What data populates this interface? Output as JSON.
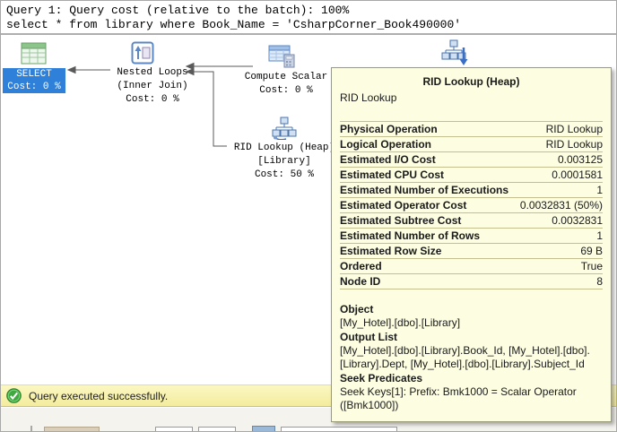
{
  "query_header": {
    "line1": "Query 1: Query cost (relative to the batch): 100%",
    "line2": "select * from library where Book_Name = 'CsharpCorner_Book490000'"
  },
  "plan": {
    "select": {
      "title": "SELECT",
      "cost": "Cost: 0 %"
    },
    "nested_loops": {
      "line1": "Nested Loops",
      "line2": "(Inner Join)",
      "cost": "Cost: 0 %"
    },
    "compute_scalar": {
      "line1": "Compute Scalar",
      "cost": "Cost: 0 %"
    },
    "rid_lookup": {
      "line1": "RID Lookup (Heap)",
      "line2": "[Library]",
      "cost": "Cost: 50 %"
    }
  },
  "tooltip": {
    "title": "RID Lookup (Heap)",
    "subtitle": "RID Lookup",
    "rows": [
      {
        "label": "Physical Operation",
        "value": "RID Lookup"
      },
      {
        "label": "Logical Operation",
        "value": "RID Lookup"
      },
      {
        "label": "Estimated I/O Cost",
        "value": "0.003125"
      },
      {
        "label": "Estimated CPU Cost",
        "value": "0.0001581"
      },
      {
        "label": "Estimated Number of Executions",
        "value": "1"
      },
      {
        "label": "Estimated Operator Cost",
        "value": "0.0032831 (50%)"
      },
      {
        "label": "Estimated Subtree Cost",
        "value": "0.0032831"
      },
      {
        "label": "Estimated Number of Rows",
        "value": "1"
      },
      {
        "label": "Estimated Row Size",
        "value": "69 B"
      },
      {
        "label": "Ordered",
        "value": "True"
      },
      {
        "label": "Node ID",
        "value": "8"
      }
    ],
    "sections": [
      {
        "heading": "Object",
        "text": "[My_Hotel].[dbo].[Library]"
      },
      {
        "heading": "Output List",
        "text": "[My_Hotel].[dbo].[Library].Book_Id, [My_Hotel].[dbo].[Library].Dept, [My_Hotel].[dbo].[Library].Subject_Id"
      },
      {
        "heading": "Seek Predicates",
        "text": "Seek Keys[1]: Prefix: Bmk1000 = Scalar Operator ([Bmk1000])"
      }
    ]
  },
  "status_bar": {
    "message": "Query executed successfully."
  },
  "colors": {
    "select_highlight": "#2e80d9",
    "tooltip_background": "#fdfde2",
    "tooltip_separator": "#c3bf8e",
    "status_background": "#f7f1a8",
    "success_green": "#3fa83f",
    "icon_blue": "#4a74ad",
    "icon_green": "#69a069"
  }
}
